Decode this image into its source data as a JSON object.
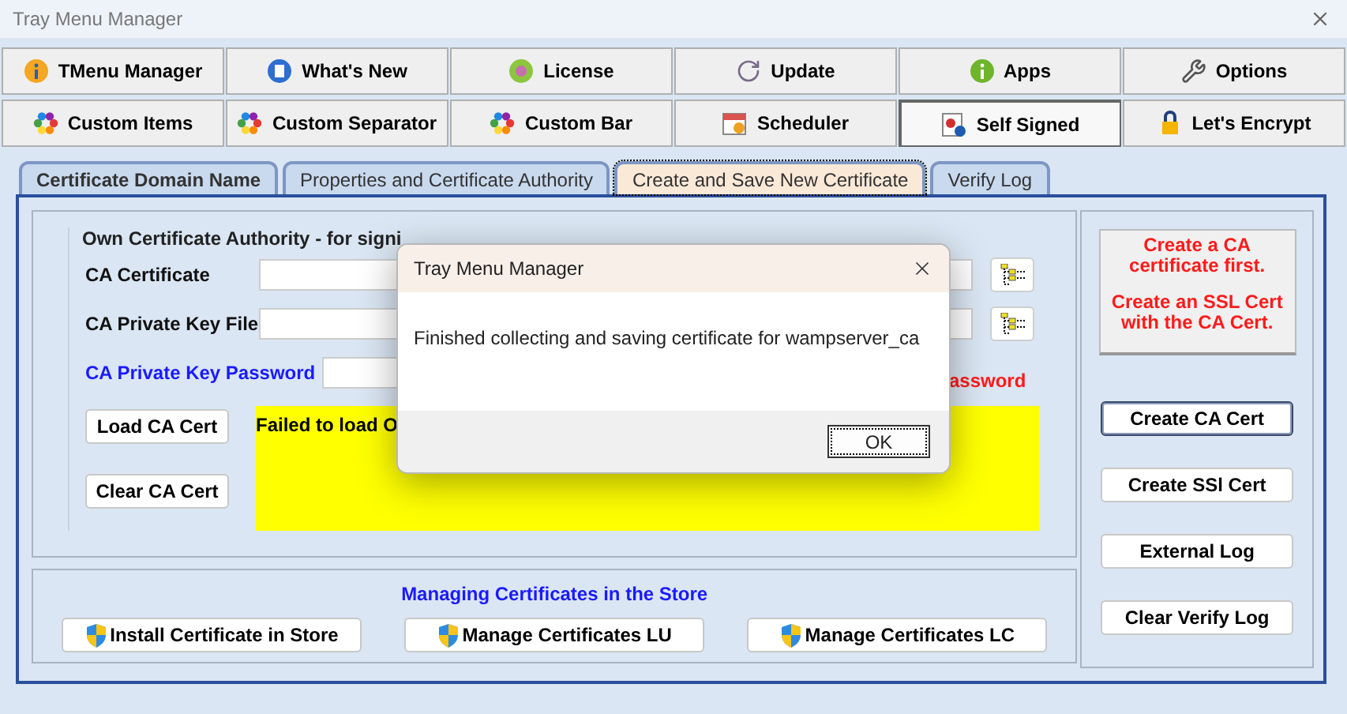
{
  "window": {
    "title": "Tray Menu Manager"
  },
  "toolbar": [
    {
      "label": "TMenu Manager",
      "selected": false
    },
    {
      "label": "What's New",
      "selected": false
    },
    {
      "label": "License",
      "selected": false
    },
    {
      "label": "Update",
      "selected": false
    },
    {
      "label": "Apps",
      "selected": false
    },
    {
      "label": "Options",
      "selected": false
    },
    {
      "label": "Custom Items",
      "selected": false
    },
    {
      "label": "Custom Separator",
      "selected": false
    },
    {
      "label": "Custom Bar",
      "selected": false
    },
    {
      "label": "Scheduler",
      "selected": false
    },
    {
      "label": "Self Signed",
      "selected": true
    },
    {
      "label": "Let's Encrypt",
      "selected": false
    }
  ],
  "tabs": [
    {
      "label": "Certificate Domain Name",
      "selected": false
    },
    {
      "label": "Properties and Certificate Authority",
      "selected": false
    },
    {
      "label": "Create and Save New Certificate",
      "selected": true
    },
    {
      "label": "Verify Log",
      "selected": false
    }
  ],
  "ca_group": {
    "legend": "Own Certificate Authority - for signi",
    "fields": [
      {
        "label": "CA Certificate",
        "kind": "file"
      },
      {
        "label": "CA Private Key File",
        "kind": "file"
      },
      {
        "label": "CA Private Key Password",
        "kind": "password"
      }
    ],
    "error": "assword",
    "buttons": [
      "Load CA Cert",
      "Clear CA Cert"
    ],
    "status_text": "Failed to load O"
  },
  "store_group": {
    "title": "Managing Certificates in the Store",
    "buttons": [
      "Install Certificate in Store",
      "Manage Certificates LU",
      "Manage Certificates LC"
    ]
  },
  "side": {
    "notice": [
      "Create a CA certificate first.",
      "Create an SSL Cert with the CA Cert."
    ],
    "buttons": [
      {
        "label": "Create CA Cert",
        "default": true
      },
      {
        "label": "Create SSl Cert",
        "default": false
      },
      {
        "label": "External Log",
        "default": false
      },
      {
        "label": "Clear Verify Log",
        "default": false
      }
    ]
  },
  "dialog": {
    "title": "Tray Menu Manager",
    "message": "Finished collecting and saving certificate for wampserver_ca",
    "button": "OK"
  }
}
